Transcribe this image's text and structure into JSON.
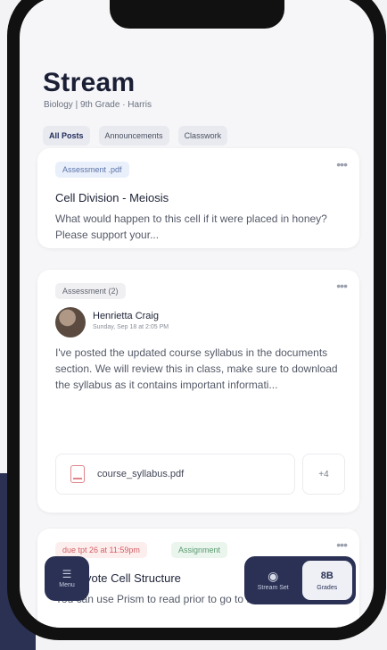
{
  "header": {
    "title": "Stream",
    "subtitle": "Biology | 9th Grade · Harris"
  },
  "tabs": [
    {
      "label": "All Posts",
      "active": true
    },
    {
      "label": "Announcements",
      "active": false
    },
    {
      "label": "Classwork",
      "active": false
    }
  ],
  "posts": [
    {
      "tag": "Assessment .pdf",
      "title": "Cell Division - Meiosis",
      "body": "What would happen to this cell if it were placed in honey? Please support your..."
    },
    {
      "tag": "Assessment (2)",
      "author": "Henrietta Craig",
      "date": "Sunday, Sep 18 at 2:05 PM",
      "body": "I've posted the updated course syllabus in the documents section. We will review this in class, make sure to download the syllabus as it contains important informati...",
      "attachment": "course_syllabus.pdf",
      "more_files": "+4"
    },
    {
      "due": "due tpt 26 at 11:59pm",
      "tag": "Assignment",
      "title": "Eukaryote Cell Structure",
      "body": "You can use Prism to read prior to go to for"
    }
  ],
  "bottom_nav": {
    "menu_label": "Menu",
    "segment_left_label": "Stream Set",
    "segment_right_label": "Grades",
    "segment_right_icon_text": "8B"
  },
  "colors": {
    "navy": "#2a3154",
    "accent_red": "#d25f64"
  }
}
